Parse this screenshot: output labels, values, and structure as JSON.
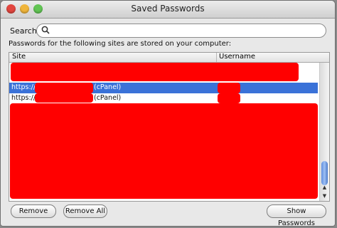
{
  "window": {
    "title": "Saved Passwords"
  },
  "search": {
    "label": "Search:",
    "value": "",
    "placeholder": ""
  },
  "description": "Passwords for the following sites are stored on your computer:",
  "table": {
    "columns": [
      "Site",
      "Username"
    ],
    "rows": [
      {
        "site_prefix": "https://",
        "site_suffix": "(cPanel)",
        "selected": true
      },
      {
        "site_prefix": "https://",
        "site_suffix": "(cPanel)",
        "selected": false
      }
    ]
  },
  "buttons": {
    "remove": "Remove",
    "remove_all": "Remove All",
    "show_passwords": "Show Passwords"
  },
  "colors": {
    "selection": "#3a72d8",
    "redaction": "#ff0000"
  },
  "icons": {
    "search": "search-icon"
  }
}
